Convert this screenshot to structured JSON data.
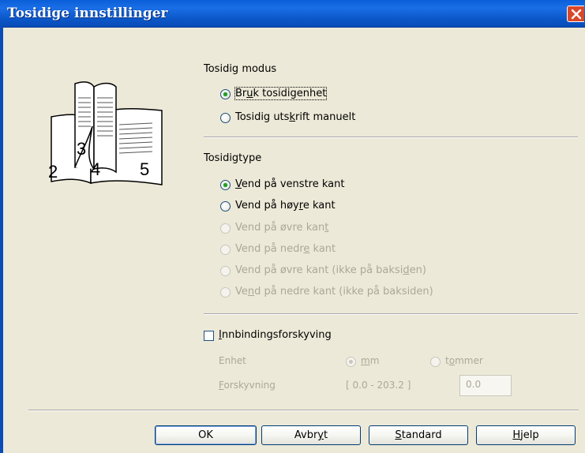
{
  "window": {
    "title": "Tosidige innstillinger"
  },
  "duplex_mode": {
    "heading": "Tosidig modus",
    "options": [
      {
        "pre": "Br",
        "key": "u",
        "post": "k tosidigenhet",
        "selected": true,
        "enabled": true
      },
      {
        "pre": "Tosidig uts",
        "key": "k",
        "post": "rift manuelt",
        "selected": false,
        "enabled": true
      }
    ]
  },
  "duplex_type": {
    "heading": "Tosidigtype",
    "options": [
      {
        "pre": "",
        "key": "V",
        "post": "end på venstre kant",
        "selected": true,
        "enabled": true
      },
      {
        "pre": "Vend på høy",
        "key": "r",
        "post": "e kant",
        "selected": false,
        "enabled": true
      },
      {
        "pre": "Vend på øvre kan",
        "key": "t",
        "post": "",
        "selected": false,
        "enabled": false
      },
      {
        "pre": "Vend på nedr",
        "key": "e",
        "post": " kant",
        "selected": false,
        "enabled": false
      },
      {
        "pre": "Vend på øvre kant (ikke på baksi",
        "key": "d",
        "post": "en)",
        "selected": false,
        "enabled": false
      },
      {
        "pre": "Ve",
        "key": "n",
        "post": "d på nedre kant (ikke på baksiden)",
        "selected": false,
        "enabled": false
      }
    ]
  },
  "binding_offset": {
    "checkbox": {
      "pre": "",
      "key": "I",
      "post": "nnbindingsforskyving",
      "checked": false
    },
    "unit_label": "Enhet",
    "unit_mm": {
      "pre": "",
      "key": "m",
      "post": "m",
      "selected": true
    },
    "unit_inch": {
      "pre": "t",
      "key": "o",
      "post": "mmer",
      "selected": false
    },
    "offset_label": {
      "pre": "",
      "key": "F",
      "post": "orskyvning"
    },
    "range": "[ 0.0 - 203.2 ]",
    "value": "0.0"
  },
  "illustration": {
    "page_numbers": [
      "2",
      "3",
      "4",
      "5"
    ]
  },
  "buttons": {
    "ok": "OK",
    "cancel": {
      "pre": "Avbr",
      "key": "y",
      "post": "t"
    },
    "default": {
      "pre": "",
      "key": "S",
      "post": "tandard"
    },
    "help": {
      "pre": "",
      "key": "H",
      "post": "jelp"
    }
  },
  "colors": {
    "titlebar": "#0a5fd8",
    "dialog_bg": "#ece9d8",
    "radio_checked": "#21a121",
    "close_button": "#d9482a"
  }
}
